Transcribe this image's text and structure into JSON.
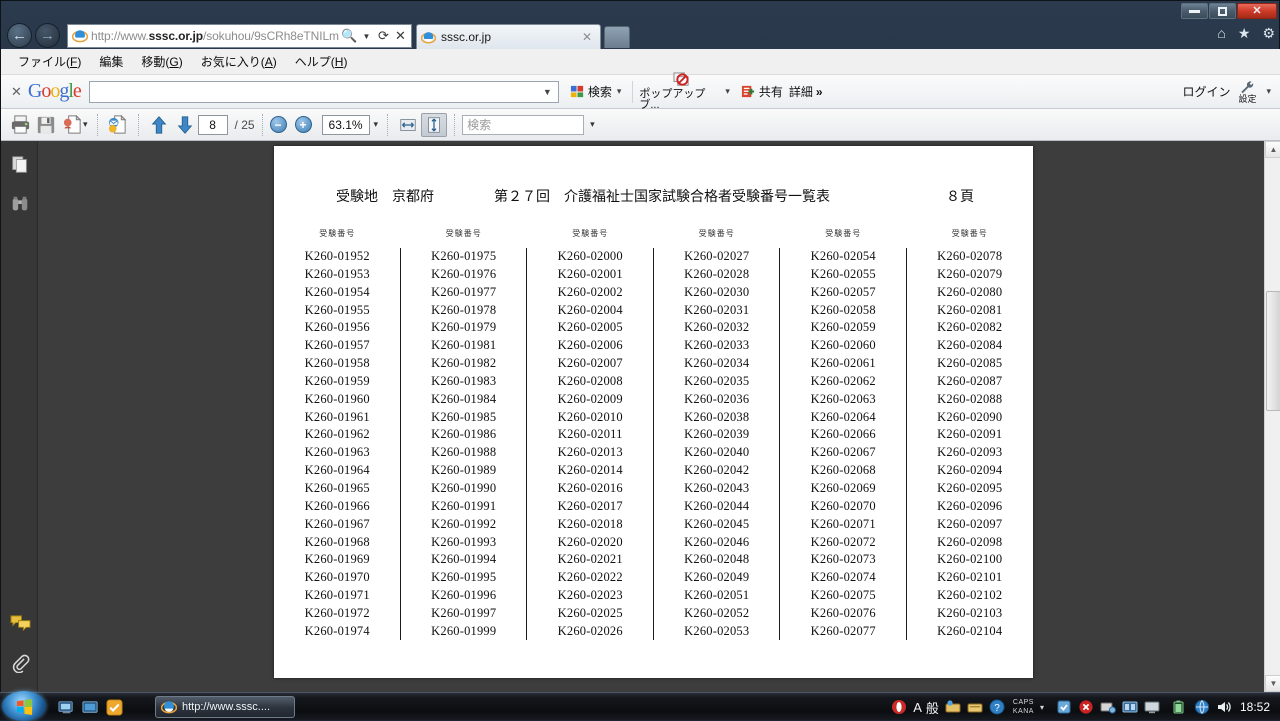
{
  "window": {
    "minimize_label": "—",
    "restore_label": "❐",
    "close_label": "✕"
  },
  "browser": {
    "back_label": "←",
    "forward_label": "→",
    "address": {
      "protocol_prefix": "http://www.",
      "domain": "sssc.or.jp",
      "path": "/sokuhou/9sCRh8eTNILm",
      "full": "http://www.sssc.or.jp/sokuhou/9sCRh8eTNILm",
      "search_icon": "search-icon",
      "dropdown_icon": "chevron-down-icon",
      "refresh_icon": "refresh-icon",
      "stop_icon": "stop-icon"
    },
    "tabs": [
      {
        "label": "sssc.or.jp",
        "close_label": "✕"
      }
    ],
    "right_icons": [
      {
        "name": "home-icon",
        "glyph": "⌂"
      },
      {
        "name": "favorites-icon",
        "glyph": "★"
      },
      {
        "name": "tools-gear-icon",
        "glyph": "⚙"
      }
    ]
  },
  "menubar": {
    "items": [
      {
        "text": "ファイル",
        "accel": "F"
      },
      {
        "text": "編集",
        "accel": ""
      },
      {
        "text": "移動",
        "accel": "G"
      },
      {
        "text": "お気に入り",
        "accel": "A"
      },
      {
        "text": "ヘルプ",
        "accel": "H"
      }
    ]
  },
  "google_toolbar": {
    "close_label": "✕",
    "logo": {
      "g1": "G",
      "o1": "o",
      "o2": "o",
      "g2": "g",
      "l": "l",
      "e": "e"
    },
    "search_value": "",
    "search_placeholder": "",
    "search_button_label": "検索",
    "popup_blocker_label": "ポップアップ ブ...",
    "share_label": "共有",
    "more_label": "詳細",
    "more_chevrons": "»",
    "login_label": "ログイン",
    "settings_label": "設定",
    "caret": "▾"
  },
  "pdf_toolbar": {
    "print_icon": "printer-icon",
    "save_icon": "save-icon",
    "export_icon": "export-pdf-icon",
    "email_icon": "email-pdf-icon",
    "prev_page_icon": "arrow-up-icon",
    "next_page_icon": "arrow-down-icon",
    "current_page": "8",
    "page_total": "/ 25",
    "zoom_out_label": "−",
    "zoom_in_label": "+",
    "zoom_level": "63.1%",
    "zoom_caret": "▾",
    "fit_width_icon": "fit-width-icon",
    "fit_page_icon": "fit-page-icon",
    "find_value": "検索",
    "find_caret": "▾"
  },
  "pdf_sidebar": {
    "items": [
      {
        "name": "pages-panel-icon"
      },
      {
        "name": "search-binoculars-icon"
      },
      {
        "name": "comments-panel-icon"
      },
      {
        "name": "attachments-paperclip-icon"
      }
    ]
  },
  "document": {
    "exam_site_label": "受験地　京都府",
    "title": "第２７回　介護福祉士国家試験合格者受験番号一覧表",
    "page_label": "８頁",
    "column_header": "受験番号",
    "columns": [
      [
        "K260-01952",
        "K260-01953",
        "K260-01954",
        "K260-01955",
        "K260-01956",
        "K260-01957",
        "K260-01958",
        "K260-01959",
        "K260-01960",
        "K260-01961",
        "K260-01962",
        "K260-01963",
        "K260-01964",
        "K260-01965",
        "K260-01966",
        "K260-01967",
        "K260-01968",
        "K260-01969",
        "K260-01970",
        "K260-01971",
        "K260-01972",
        "K260-01974"
      ],
      [
        "K260-01975",
        "K260-01976",
        "K260-01977",
        "K260-01978",
        "K260-01979",
        "K260-01981",
        "K260-01982",
        "K260-01983",
        "K260-01984",
        "K260-01985",
        "K260-01986",
        "K260-01988",
        "K260-01989",
        "K260-01990",
        "K260-01991",
        "K260-01992",
        "K260-01993",
        "K260-01994",
        "K260-01995",
        "K260-01996",
        "K260-01997",
        "K260-01999"
      ],
      [
        "K260-02000",
        "K260-02001",
        "K260-02002",
        "K260-02004",
        "K260-02005",
        "K260-02006",
        "K260-02007",
        "K260-02008",
        "K260-02009",
        "K260-02010",
        "K260-02011",
        "K260-02013",
        "K260-02014",
        "K260-02016",
        "K260-02017",
        "K260-02018",
        "K260-02020",
        "K260-02021",
        "K260-02022",
        "K260-02023",
        "K260-02025",
        "K260-02026"
      ],
      [
        "K260-02027",
        "K260-02028",
        "K260-02030",
        "K260-02031",
        "K260-02032",
        "K260-02033",
        "K260-02034",
        "K260-02035",
        "K260-02036",
        "K260-02038",
        "K260-02039",
        "K260-02040",
        "K260-02042",
        "K260-02043",
        "K260-02044",
        "K260-02045",
        "K260-02046",
        "K260-02048",
        "K260-02049",
        "K260-02051",
        "K260-02052",
        "K260-02053"
      ],
      [
        "K260-02054",
        "K260-02055",
        "K260-02057",
        "K260-02058",
        "K260-02059",
        "K260-02060",
        "K260-02061",
        "K260-02062",
        "K260-02063",
        "K260-02064",
        "K260-02066",
        "K260-02067",
        "K260-02068",
        "K260-02069",
        "K260-02070",
        "K260-02071",
        "K260-02072",
        "K260-02073",
        "K260-02074",
        "K260-02075",
        "K260-02076",
        "K260-02077"
      ],
      [
        "K260-02078",
        "K260-02079",
        "K260-02080",
        "K260-02081",
        "K260-02082",
        "K260-02084",
        "K260-02085",
        "K260-02087",
        "K260-02088",
        "K260-02090",
        "K260-02091",
        "K260-02093",
        "K260-02094",
        "K260-02095",
        "K260-02096",
        "K260-02097",
        "K260-02098",
        "K260-02100",
        "K260-02101",
        "K260-02102",
        "K260-02103",
        "K260-02104"
      ]
    ]
  },
  "taskbar": {
    "start_label": "start-orb",
    "quicklaunch": [
      {
        "name": "show-desktop-icon"
      },
      {
        "name": "media-player-icon"
      },
      {
        "name": "norton-icon"
      }
    ],
    "tasks": [
      {
        "label": "http://www.sssc....",
        "icon": "ie-icon"
      }
    ],
    "tray": {
      "ime_mode": "A",
      "ime_kind": "般",
      "caps_label": "CAPS",
      "kana_label": "KANA",
      "ime_caret": "▾",
      "clock": "18:52"
    }
  },
  "colors": {
    "accent_blue": "#3f7fb5",
    "close_red": "#cd3b27",
    "taskbar_dark": "#0b0d10",
    "page_white": "#ffffff",
    "pdf_bg": "#3d3d3d"
  }
}
